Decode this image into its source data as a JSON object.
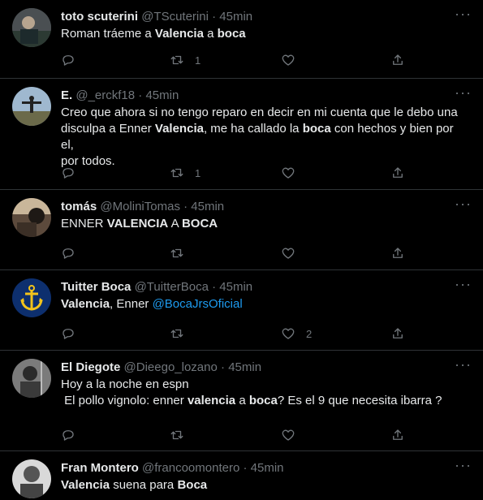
{
  "tweets": [
    {
      "name": "toto scuterini",
      "handle": "@TScuterini",
      "time": "45min",
      "lines": [
        "Roman tráeme a **Valencia** a **boca**"
      ],
      "retweets": "1",
      "likes": ""
    },
    {
      "name": "E.",
      "handle": "@_erckf18",
      "time": "45min",
      "lines": [
        "Creo que ahora si no tengo reparo en decir en mi cuenta que le debo una",
        "disculpa a Enner **Valencia**, me ha callado la **boca** con hechos y bien por el,",
        "por todos."
      ],
      "retweets": "1",
      "likes": ""
    },
    {
      "name": "tomás",
      "handle": "@MoliniTomas",
      "time": "45min",
      "lines": [
        "ENNER **VALENCIA** A **BOCA**"
      ],
      "retweets": "",
      "likes": ""
    },
    {
      "name": "Tuitter Boca",
      "handle": "@TuitterBoca",
      "time": "45min",
      "lines": [
        "**Valencia**, Enner [[@BocaJrsOficial]]"
      ],
      "retweets": "",
      "likes": "2"
    },
    {
      "name": "El Diegote",
      "handle": "@Dieego_lozano",
      "time": "45min",
      "lines": [
        "Hoy a la noche en espn",
        " El pollo vignolo: enner **valencia** a **boca**? Es el 9 que necesita ibarra ?"
      ],
      "retweets": "",
      "likes": ""
    },
    {
      "name": "Fran Montero",
      "handle": "@francoomontero",
      "time": "45min",
      "lines": [
        "**Valencia** suena para **Boca**"
      ],
      "retweets": "",
      "likes": ""
    }
  ],
  "separator": "·",
  "more_glyph": "···",
  "icons": [
    "reply-icon",
    "retweet-icon",
    "like-icon",
    "share-icon",
    "more-icon"
  ],
  "colors": {
    "background": "#000000",
    "text": "#e7e9ea",
    "muted": "#71767b",
    "link": "#1d9bf0",
    "border": "#2f3336"
  }
}
